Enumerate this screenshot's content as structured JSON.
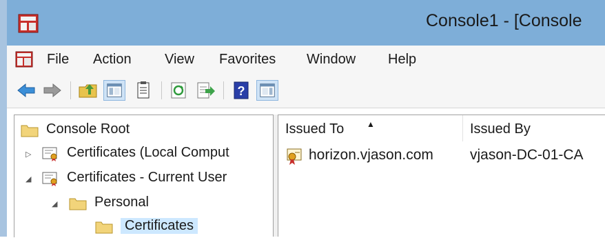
{
  "window": {
    "title": "Console1 - [Console"
  },
  "menu": [
    "File",
    "Action",
    "View",
    "Favorites",
    "Window",
    "Help"
  ],
  "toolbar": {
    "buttons": [
      "back-arrow-icon",
      "forward-arrow-icon",
      "up-folder-icon",
      "show-hide-tree-icon",
      "properties-icon",
      "refresh-icon",
      "export-list-icon",
      "help-icon",
      "show-hide-action-pane-icon"
    ]
  },
  "tree": {
    "root": "Console Root",
    "items": [
      {
        "label": "Certificates (Local Comput"
      },
      {
        "label": "Certificates - Current User"
      },
      {
        "label": "Personal"
      },
      {
        "label": "Certificates"
      }
    ]
  },
  "list": {
    "columns": [
      "Issued To",
      "Issued By"
    ],
    "rows": [
      {
        "issued_to": "horizon.vjason.com",
        "issued_by": "vjason-DC-01-CA"
      }
    ]
  },
  "colors": {
    "titlebar": "#7eaed8",
    "selection": "#cde8ff",
    "folder": "#f2d47a"
  }
}
